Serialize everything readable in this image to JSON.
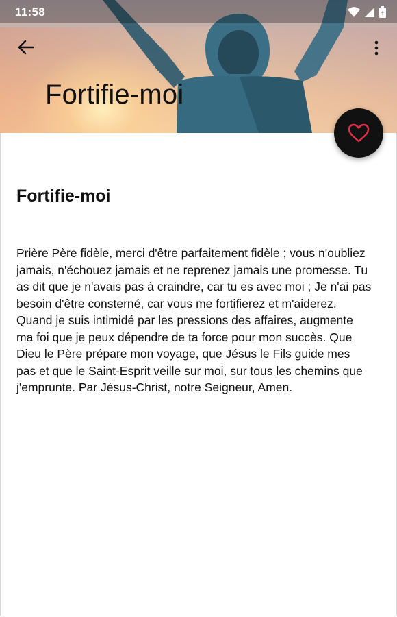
{
  "status_bar": {
    "time": "11:58",
    "icons": [
      "wifi-icon",
      "signal-icon",
      "battery-icon"
    ]
  },
  "app_bar": {
    "back_icon": "arrow-left-icon",
    "menu_icon": "more-vert-icon"
  },
  "header": {
    "title": "Fortifie-moi"
  },
  "fab": {
    "icon": "heart-outline-icon",
    "icon_color": "#e0304a",
    "background": "#111111"
  },
  "content": {
    "title": "Fortifie-moi",
    "prayer": "Prière Père fidèle, merci d'être parfaitement fidèle ; vous n'oubliez jamais, n'échouez jamais et ne reprenez jamais une promesse. Tu as dit que je n'avais pas à craindre, car tu es avec moi ; Je n'ai pas besoin d'être consterné, car vous me fortifierez et m'aiderez. Quand je suis intimidé par les pressions des affaires, augmente ma foi que je peux dépendre de ta force pour mon succès. Que Dieu le Père prépare mon voyage, que Jésus le Fils guide mes pas et que le Saint-Esprit veille sur moi, sur tous les chemins que j'emprunte. Par Jésus-Christ, notre Seigneur, Amen."
  }
}
